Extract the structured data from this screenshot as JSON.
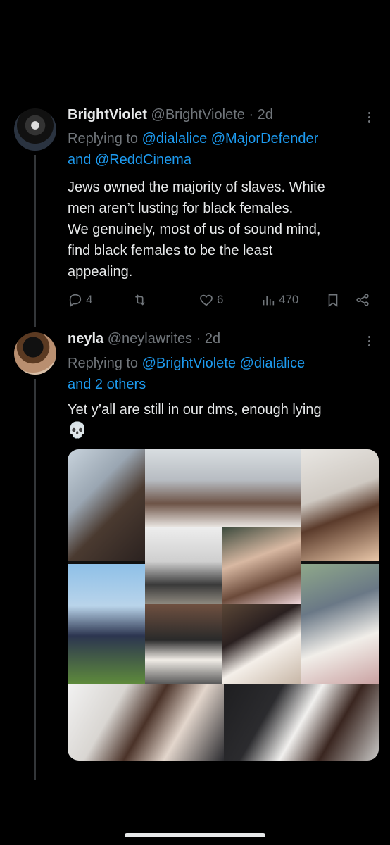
{
  "tweets": [
    {
      "name": "BrightViolet",
      "handle": "@BrightViolete",
      "sep": "·",
      "time": "2d",
      "replying_prefix": "Replying to",
      "mentions_line1": "@dialalice @MajorDefender",
      "and_word": "and",
      "mentions_line2": "@ReddCinema",
      "text_lines": [
        "Jews owned the majority of slaves. White",
        "men aren’t lusting for black females.",
        "We genuinely, most of us of sound mind,",
        "find black females to be the least",
        "appealing."
      ],
      "replies": "4",
      "reposts": "",
      "likes": "6",
      "views": "470"
    },
    {
      "name": "neyla",
      "handle": "@neylawrites",
      "sep": "·",
      "time": "2d",
      "replying_prefix": "Replying to",
      "mentions_line1": "@BrightViolete @dialalice",
      "mentions_line2": "and 2 others",
      "text_line1": "Yet y’all are still in our dms, enough lying",
      "emoji": "💀"
    }
  ],
  "icons": [
    "reply-icon",
    "repost-icon",
    "like-icon",
    "views-icon",
    "bookmark-icon",
    "share-icon",
    "more-icon"
  ],
  "colors": {
    "background": "#000000",
    "text": "#e7e9ea",
    "muted": "#71767b",
    "link": "#1d9bf0"
  }
}
